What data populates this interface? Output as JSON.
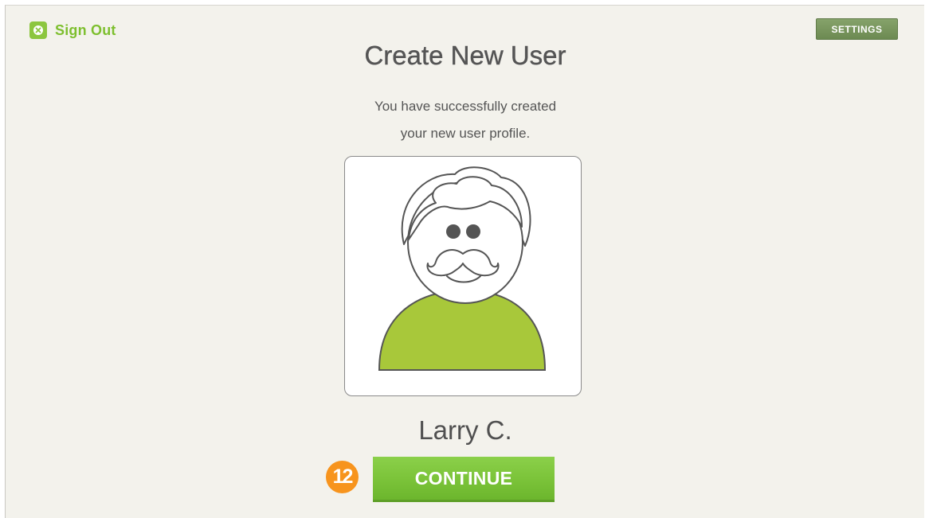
{
  "header": {
    "sign_out_label": "Sign Out",
    "settings_label": "SETTINGS"
  },
  "main": {
    "title": "Create New User",
    "message_line1": "You have successfully created",
    "message_line2": "your new user profile.",
    "user_name": "Larry C.",
    "continue_label": "CONTINUE",
    "step_number": "12"
  },
  "colors": {
    "accent_green": "#8cc63f",
    "settings_green": "#6c8a52",
    "badge_orange": "#f7941d",
    "shirt_green": "#a8c83a",
    "background": "#f3f2ec"
  },
  "icons": {
    "sign_out": "close-circle-icon",
    "avatar": "user-avatar-mustache"
  }
}
